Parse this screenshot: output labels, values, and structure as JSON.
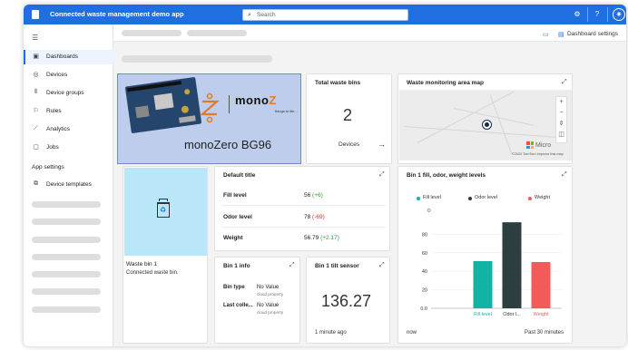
{
  "app": {
    "title": "Connected waste management demo app"
  },
  "search": {
    "placeholder": "Search"
  },
  "toolbar": {
    "dashboard_settings": "Dashboard settings",
    "help_label": "?"
  },
  "sidebar": {
    "items": [
      {
        "label": "Dashboards",
        "icon": "dashboard-icon",
        "active": true
      },
      {
        "label": "Devices",
        "icon": "devices-icon"
      },
      {
        "label": "Device groups",
        "icon": "device-groups-icon"
      },
      {
        "label": "Rules",
        "icon": "rules-icon"
      },
      {
        "label": "Analytics",
        "icon": "analytics-icon"
      },
      {
        "label": "Jobs",
        "icon": "jobs-icon"
      }
    ],
    "app_settings_heading": "App settings",
    "settings_items": [
      {
        "label": "Device templates",
        "icon": "device-templates-icon"
      }
    ]
  },
  "image_tile": {
    "logo_mono": "mono",
    "logo_z": "Z",
    "tagline": "things to life...",
    "caption": "monoZero  BG96"
  },
  "total_bins": {
    "title": "Total waste bins",
    "value": "2",
    "footer": "Devices"
  },
  "map_tile": {
    "title": "Waste monitoring area map",
    "provider": "Micro",
    "credit": "©2020 TomTom  Improve this map"
  },
  "bin_tile": {
    "name": "Waste bin 1",
    "description": "Connected waste bin."
  },
  "default_tile": {
    "title": "Default title",
    "rows": [
      {
        "label": "Fill level",
        "value": "56",
        "delta": "(+6)",
        "trend": "up"
      },
      {
        "label": "Odor level",
        "value": "78",
        "delta": "(-69)",
        "trend": "down"
      },
      {
        "label": "Weight",
        "value": "56.79",
        "delta": "(+2.17)",
        "trend": "up"
      }
    ]
  },
  "info_tile": {
    "title": "Bin 1 info",
    "rows": [
      {
        "label": "Bin type",
        "value": "No Value",
        "sub": "cloud property"
      },
      {
        "label": "Last colle...",
        "value": "No Value",
        "sub": "cloud property"
      }
    ]
  },
  "tilt_tile": {
    "title": "Bin 1 tilt sensor",
    "value": "136.27",
    "time": "1 minute ago"
  },
  "chart_tile": {
    "title": "Bin 1 fill, odor, weight levels",
    "footer_left": "now",
    "footer_right": "Past 30 minutes"
  },
  "chart_data": {
    "type": "bar",
    "categories": [
      "Fill level",
      "Odor l...",
      "Weight"
    ],
    "tick_labels": [
      "0.0",
      "20",
      "40",
      "60",
      "80"
    ],
    "series": [
      {
        "name": "Fill level",
        "value": 51,
        "color": "#12b3a5"
      },
      {
        "name": "Odor level",
        "value": 93,
        "color": "#2c3e40"
      },
      {
        "name": "Weight",
        "value": 50,
        "color": "#f35a5a"
      }
    ],
    "ylim": [
      0,
      100
    ],
    "legend": "top"
  }
}
